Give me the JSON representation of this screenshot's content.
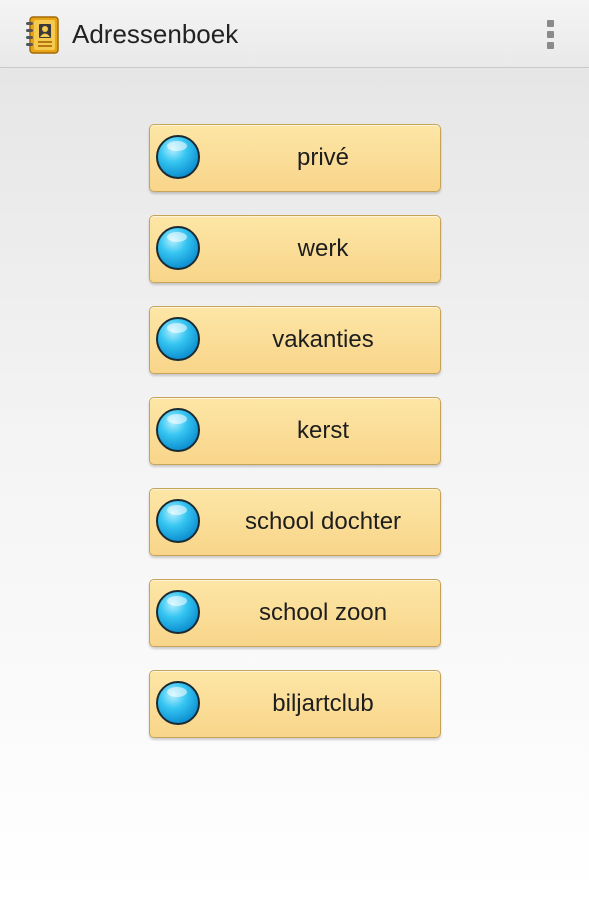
{
  "app": {
    "title": "Adressenboek",
    "icon": "address-book-icon",
    "overflow_icon": "overflow-menu-icon"
  },
  "categories": [
    {
      "label": "privé",
      "icon": "blue-bullet-icon"
    },
    {
      "label": "werk",
      "icon": "blue-bullet-icon"
    },
    {
      "label": "vakanties",
      "icon": "blue-bullet-icon"
    },
    {
      "label": "kerst",
      "icon": "blue-bullet-icon"
    },
    {
      "label": "school dochter",
      "icon": "blue-bullet-icon"
    },
    {
      "label": "school zoon",
      "icon": "blue-bullet-icon"
    },
    {
      "label": "biljartclub",
      "icon": "blue-bullet-icon"
    }
  ],
  "colors": {
    "button_fill": "#fbdc97",
    "button_border": "#c7a35a",
    "bullet_blue": "#1ab0e8"
  }
}
